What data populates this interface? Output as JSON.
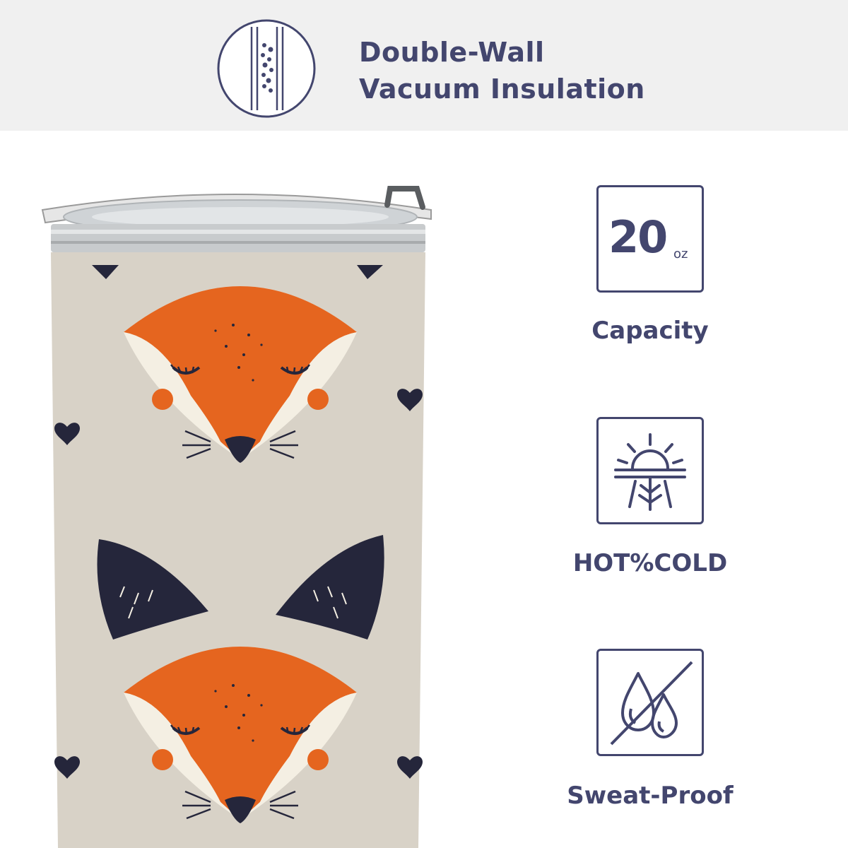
{
  "header": {
    "headline_line1": "Double-Wall",
    "headline_line2": "Vacuum Insulation",
    "icon": "insulation-wall-icon"
  },
  "product": {
    "pattern": "fox-face-heart-pattern",
    "colors": {
      "body": "#d8d2c7",
      "fox_orange": "#e5651f",
      "fox_cream": "#f4efe3",
      "ink": "#25263b"
    }
  },
  "features": [
    {
      "icon": "capacity-icon",
      "number": "20",
      "unit": "oz",
      "label": "Capacity"
    },
    {
      "icon": "sun-snowflake-icon",
      "label": "HOT%COLD"
    },
    {
      "icon": "no-sweat-drops-icon",
      "label": "Sweat-Proof"
    }
  ],
  "colors": {
    "accent": "#43466e",
    "band": "#f0f0f0"
  }
}
